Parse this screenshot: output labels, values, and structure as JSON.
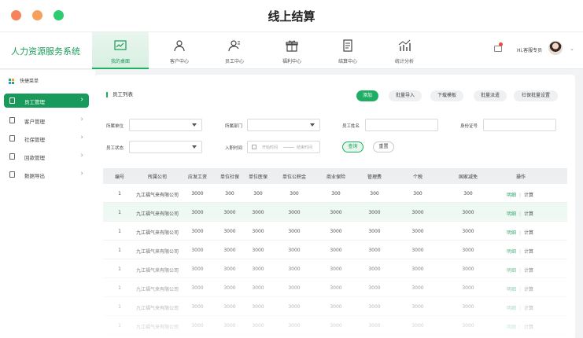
{
  "window": {
    "title": "线上结算"
  },
  "header": {
    "brand": "人力资源服务系统",
    "tabs": [
      {
        "label": "我的桌面",
        "icon": "chart-icon",
        "active": true
      },
      {
        "label": "客户中心",
        "icon": "customer-icon",
        "active": false
      },
      {
        "label": "员工中心",
        "icon": "employee-icon",
        "active": false
      },
      {
        "label": "福利中心",
        "icon": "gift-icon",
        "active": false
      },
      {
        "label": "结算中心",
        "icon": "settlement-icon",
        "active": false
      },
      {
        "label": "统计分析",
        "icon": "statistics-icon",
        "active": false
      }
    ],
    "greeting": "Hi,客服专员"
  },
  "sidebar": {
    "quick_menu": "快捷菜单",
    "items": [
      {
        "label": "员工管理",
        "icon": "employee-card-icon",
        "active": true
      },
      {
        "label": "客户管理",
        "icon": "customer-card-icon",
        "active": false
      },
      {
        "label": "社保管理",
        "icon": "insurance-icon",
        "active": false
      },
      {
        "label": "回款管理",
        "icon": "payment-icon",
        "active": false
      },
      {
        "label": "数据导出",
        "icon": "export-icon",
        "active": false
      }
    ]
  },
  "main": {
    "section_title": "员工列表",
    "actions": [
      "添加",
      "批量导入",
      "下载模板",
      "批量派遣",
      "社保批量设置"
    ],
    "filters": {
      "company_label": "所属单位",
      "dept_label": "所属部门",
      "name_label": "员工姓名",
      "id_label": "身份证号",
      "status_label": "员工状态",
      "date_label": "入职时间",
      "date_start_placeholder": "开始时间",
      "date_end_placeholder": "结束时间",
      "query_label": "查询",
      "reset_label": "重置"
    },
    "table": {
      "columns": [
        "编号",
        "所属公司",
        "应发工资",
        "单位社保",
        "单位医保",
        "单位公积金",
        "商业保险",
        "管理费",
        "个税",
        "国家减免",
        "操作"
      ],
      "op_detail": "明细",
      "op_calc": "计算",
      "rows": [
        [
          "1",
          "九江福气来有限公司",
          "3000",
          "300",
          "300",
          "300",
          "300",
          "300",
          "300",
          "300"
        ],
        [
          "1",
          "九江福气来有限公司",
          "3000",
          "3000",
          "3000",
          "3000",
          "3000",
          "3000",
          "3000",
          "3000"
        ],
        [
          "1",
          "九江福气来有限公司",
          "3000",
          "3000",
          "3000",
          "3000",
          "3000",
          "3000",
          "3000",
          "3000"
        ],
        [
          "1",
          "九江福气来有限公司",
          "3000",
          "3000",
          "3000",
          "3000",
          "3000",
          "3000",
          "3000",
          "3000"
        ],
        [
          "1",
          "九江福气来有限公司",
          "3000",
          "3000",
          "3000",
          "3000",
          "3000",
          "3000",
          "3000",
          "3000"
        ],
        [
          "1",
          "九江福气来有限公司",
          "3000",
          "3000",
          "3000",
          "3000",
          "3000",
          "3000",
          "3000",
          "3000"
        ],
        [
          "1",
          "九江福气来有限公司",
          "3000",
          "3000",
          "3000",
          "3000",
          "3000",
          "3000",
          "3000",
          "3000"
        ],
        [
          "1",
          "九江福气来有限公司",
          "3000",
          "3000",
          "3000",
          "3000",
          "3000",
          "3000",
          "3000",
          "3000"
        ]
      ]
    }
  },
  "colors": {
    "accent": "#1fae64",
    "accent_dark": "#1a9a5a",
    "highlight_row": "#edf8f2"
  }
}
